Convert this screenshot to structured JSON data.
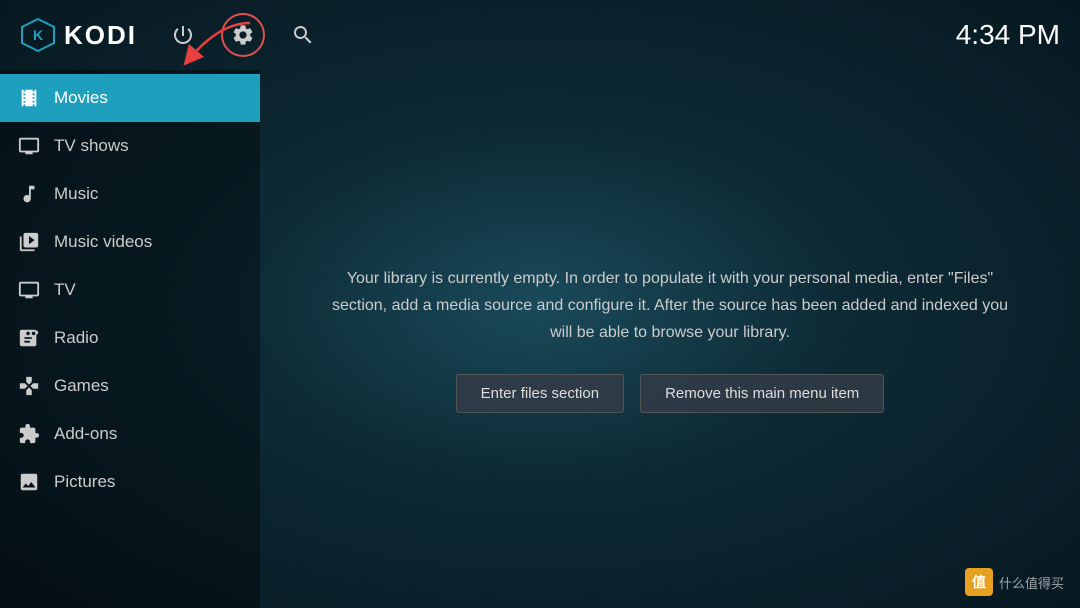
{
  "header": {
    "title": "KODI",
    "time": "4:34 PM",
    "icons": {
      "power_label": "power",
      "settings_label": "settings",
      "search_label": "search"
    }
  },
  "sidebar": {
    "items": [
      {
        "id": "movies",
        "label": "Movies",
        "active": true,
        "icon": "movies"
      },
      {
        "id": "tvshows",
        "label": "TV shows",
        "active": false,
        "icon": "tv"
      },
      {
        "id": "music",
        "label": "Music",
        "active": false,
        "icon": "music"
      },
      {
        "id": "musicvideos",
        "label": "Music videos",
        "active": false,
        "icon": "musicvideos"
      },
      {
        "id": "tv",
        "label": "TV",
        "active": false,
        "icon": "livetv"
      },
      {
        "id": "radio",
        "label": "Radio",
        "active": false,
        "icon": "radio"
      },
      {
        "id": "games",
        "label": "Games",
        "active": false,
        "icon": "games"
      },
      {
        "id": "addons",
        "label": "Add-ons",
        "active": false,
        "icon": "addons"
      },
      {
        "id": "pictures",
        "label": "Pictures",
        "active": false,
        "icon": "pictures"
      }
    ]
  },
  "content": {
    "empty_message": "Your library is currently empty. In order to populate it with your personal media, enter \"Files\" section, add a media source and configure it. After the source has been added and indexed you will be able to browse your library.",
    "btn_enter_files": "Enter files section",
    "btn_remove_item": "Remove this main menu item"
  },
  "watermark": {
    "logo": "值",
    "text": "什么值得买"
  }
}
